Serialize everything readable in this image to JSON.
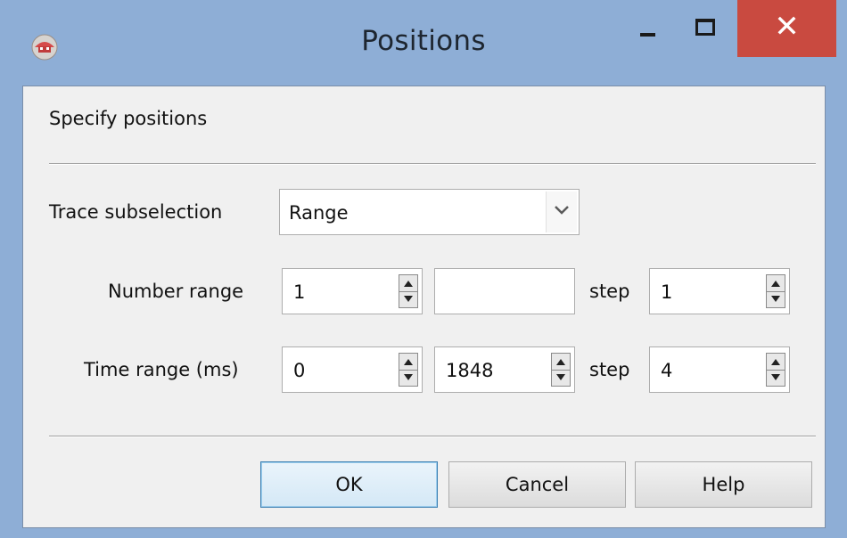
{
  "window": {
    "title": "Positions"
  },
  "titlebar": {
    "close_glyph": "✕"
  },
  "dialog": {
    "header": "Specify positions",
    "trace": {
      "label": "Trace subselection",
      "selected": "Range"
    },
    "number_range": {
      "label": "Number range",
      "from": "1",
      "to": "",
      "step_label": "step",
      "step": "1"
    },
    "time_range": {
      "label": "Time range (ms)",
      "from": "0",
      "to": "1848",
      "step_label": "step",
      "step": "4"
    }
  },
  "buttons": {
    "ok": "OK",
    "cancel": "Cancel",
    "help": "Help"
  },
  "colors": {
    "titlebar": "#8eaed6",
    "close": "#c94a40",
    "client": "#f0f0f0"
  },
  "icons": {
    "app": "app-icon",
    "combo_arrow": "chevron-down-icon",
    "spin_up": "arrow-up-icon",
    "spin_down": "arrow-down-icon"
  }
}
